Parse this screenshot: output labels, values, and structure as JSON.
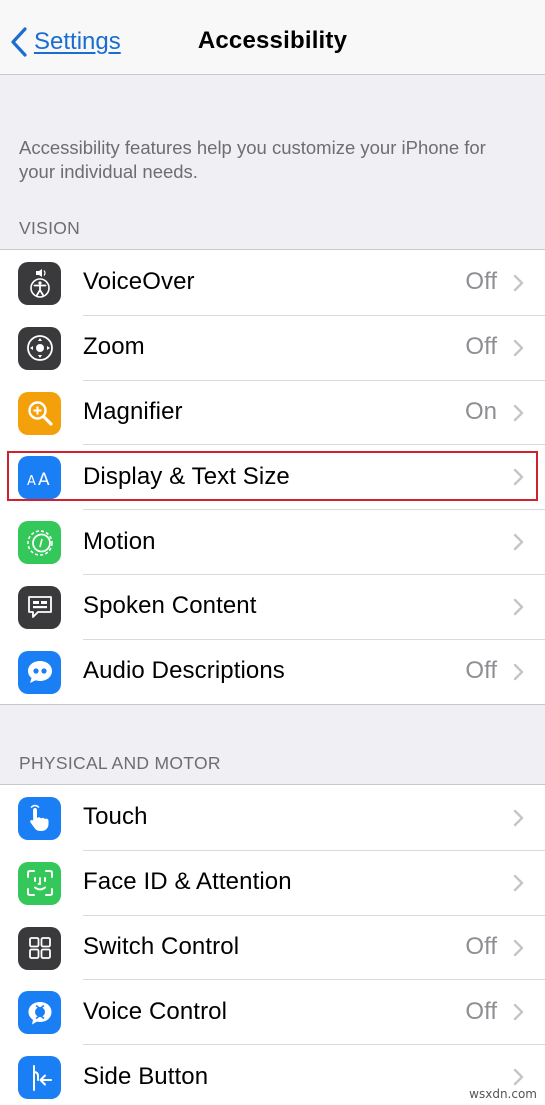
{
  "nav": {
    "back_label": "Settings",
    "title": "Accessibility"
  },
  "intro": "Accessibility features help you customize your iPhone for your individual needs.",
  "sections": [
    {
      "header": "VISION",
      "items": [
        {
          "label": "VoiceOver",
          "value": "Off",
          "icon": "voiceover-icon",
          "color": "#3a3a3c"
        },
        {
          "label": "Zoom",
          "value": "Off",
          "icon": "zoom-icon",
          "color": "#3a3a3c"
        },
        {
          "label": "Magnifier",
          "value": "On",
          "icon": "magnifier-icon",
          "color": "#f4a00b"
        },
        {
          "label": "Display & Text Size",
          "value": "",
          "icon": "text-size-icon",
          "color": "#1a7ef5"
        },
        {
          "label": "Motion",
          "value": "",
          "icon": "motion-icon",
          "color": "#34c759"
        },
        {
          "label": "Spoken Content",
          "value": "",
          "icon": "spoken-content-icon",
          "color": "#3a3a3c"
        },
        {
          "label": "Audio Descriptions",
          "value": "Off",
          "icon": "audio-descriptions-icon",
          "color": "#1a7ef5"
        }
      ]
    },
    {
      "header": "PHYSICAL AND MOTOR",
      "items": [
        {
          "label": "Touch",
          "value": "",
          "icon": "touch-hand-icon",
          "color": "#1a7ef5"
        },
        {
          "label": "Face ID & Attention",
          "value": "",
          "icon": "face-id-icon",
          "color": "#34c759"
        },
        {
          "label": "Switch Control",
          "value": "Off",
          "icon": "switch-control-icon",
          "color": "#3a3a3c"
        },
        {
          "label": "Voice Control",
          "value": "Off",
          "icon": "voice-control-icon",
          "color": "#1a7ef5"
        },
        {
          "label": "Side Button",
          "value": "",
          "icon": "side-button-icon",
          "color": "#1a7ef5"
        }
      ]
    }
  ],
  "highlight_color": "#d0222e",
  "watermark": "wsxdn.com"
}
